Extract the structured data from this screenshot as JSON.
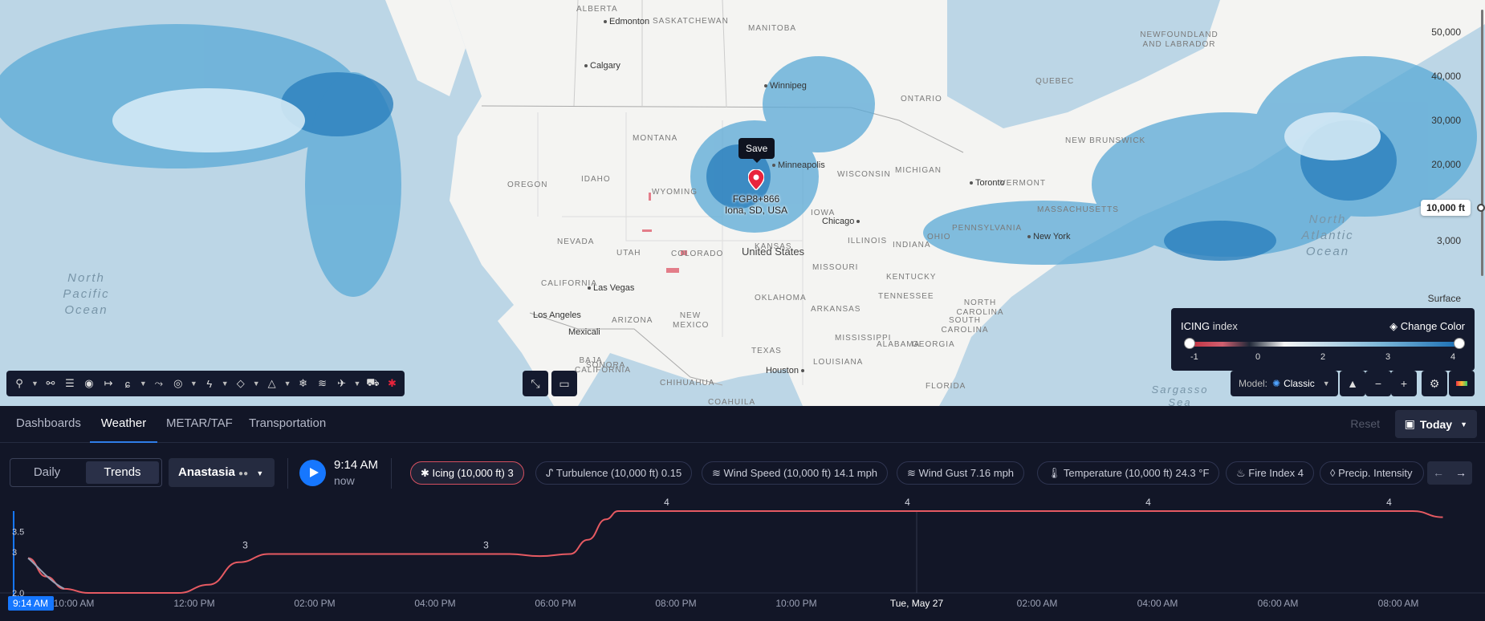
{
  "map": {
    "labels": {
      "alberta": "ALBERTA",
      "saskatchewan": "SASKATCHEWAN",
      "manitoba": "MANITOBA",
      "ontario": "ONTARIO",
      "newfoundland": "NEWFOUNDLAND AND LABRADOR",
      "quebec": "QUEBEC",
      "newbrunswick": "NEW BRUNSWICK",
      "montana": "MONTANA",
      "idaho": "IDAHO",
      "wyoming": "WYOMING",
      "oregon": "OREGON",
      "nevada": "NEVADA",
      "utah": "UTAH",
      "colorado": "COLORADO",
      "california": "CALIFORNIA",
      "arizona": "ARIZONA",
      "newmexico": "NEW MEXICO",
      "texas": "TEXAS",
      "oklahoma": "OKLAHOMA",
      "kansas": "KANSAS",
      "missouri": "MISSOURI",
      "iowa": "IOWA",
      "illinois": "ILLINOIS",
      "wisconsin": "WISCONSIN",
      "michigan": "MICHIGAN",
      "ohio": "OHIO",
      "indiana": "INDIANA",
      "kentucky": "KENTUCKY",
      "tennessee": "TENNESSEE",
      "arkansas": "ARKANSAS",
      "mississippi": "MISSISSIPPI",
      "louisiana": "LOUISIANA",
      "georgia": "GEORGIA",
      "alabama": "ALABAMA",
      "pennsylvania": "PENNSYLVANIA",
      "vermont": "VERMONT",
      "massachusetts": "MASSACHUSETTS",
      "northcarolina": "NORTH CAROLINA",
      "southcarolina": "SOUTH CAROLINA",
      "florida": "FLORIDA",
      "coahuila": "COAHUILA",
      "chihuahua": "CHIHUAHUA",
      "sonora": "SONORA",
      "baja": "BAJA CALIFORNIA"
    },
    "cities": {
      "edmonton": "Edmonton",
      "calgary": "Calgary",
      "winnipeg": "Winnipeg",
      "minneapolis": "Minneapolis",
      "chicago": "Chicago",
      "toronto": "Toronto",
      "newyork": "New York",
      "lasvegas": "Las Vegas",
      "losangeles": "Los Angeles",
      "mexicali": "Mexicali",
      "houston": "Houston"
    },
    "country": "United States",
    "oceans": {
      "np": "North Pacific Ocean",
      "na": "North Atlantic Ocean",
      "sargasso": "Sargasso Sea"
    },
    "marker": {
      "code": "FGP8+866",
      "place": "Iona, SD, USA",
      "save": "Save"
    }
  },
  "altitude": {
    "levels": [
      "50,000",
      "40,000",
      "30,000",
      "20,000",
      "3,000",
      "Surface"
    ],
    "selected": "10,000 ft"
  },
  "legend": {
    "name": "ICING",
    "suffix": "index",
    "change": "Change Color",
    "ticks": [
      "-1",
      "0",
      "2",
      "3",
      "4"
    ],
    "colors": {
      "low": "#c03040",
      "high": "#1a6fb5"
    }
  },
  "model": {
    "label": "Model:",
    "value": "Classic"
  },
  "map_tools": {
    "icons": [
      "pin-icon",
      "pins-icon",
      "sliders-icon",
      "compass-icon",
      "route-icon",
      "hurricane-icon",
      "plane-path-icon",
      "radar-icon",
      "lightning-icon",
      "layers-icon",
      "warning-icon",
      "snow-icon",
      "wind-icon",
      "airplane-icon",
      "truck-icon",
      "asterisk-icon"
    ]
  },
  "tabs": [
    "Dashboards",
    "Weather",
    "METAR/TAF",
    "Transportation"
  ],
  "active_tab": "Weather",
  "reset": "Reset",
  "today": "Today",
  "view_toggle": [
    "Daily",
    "Trends"
  ],
  "user": "Anastasia",
  "time": {
    "value": "9:14 AM",
    "sub": "now"
  },
  "chips": [
    "Icing (10,000 ft) 3",
    "Turbulence (10,000 ft) 0.15",
    "Wind Speed (10,000 ft) 14.1 mph",
    "Wind Gust 7.16 mph",
    "Temperature (10,000 ft) 24.3 °F",
    "Fire Index 4",
    "Precip. Intensity"
  ],
  "chart_data": {
    "type": "line",
    "ylim": [
      2.0,
      4.0
    ],
    "yticks": [
      "3.5",
      "3",
      "2.0"
    ],
    "x_ticks": [
      "10:00 AM",
      "12:00 PM",
      "02:00 PM",
      "04:00 PM",
      "06:00 PM",
      "08:00 PM",
      "10:00 PM",
      "Tue, May 27",
      "02:00 AM",
      "04:00 AM",
      "06:00 AM",
      "08:00 AM"
    ],
    "current_label": "9:14 AM",
    "series": [
      {
        "x_hours": [
          0,
          0.3,
          0.6,
          1.0,
          1.5,
          2.0,
          2.5,
          3.0,
          3.5,
          4.0,
          4.5,
          5.0,
          6.0,
          7.0,
          8.0,
          8.5,
          9.0,
          9.3,
          9.6,
          9.8,
          10.0,
          11.0,
          12.0,
          13.0,
          14.0,
          15.0,
          16.0,
          17.0,
          18.0,
          19.0,
          20.0,
          21.0,
          22.0,
          23.0,
          23.5
        ],
        "values": [
          2.85,
          2.4,
          2.1,
          2.0,
          2.0,
          2.0,
          2.0,
          2.2,
          2.75,
          2.95,
          2.95,
          2.95,
          2.95,
          2.95,
          2.95,
          2.9,
          2.95,
          3.3,
          3.8,
          4.0,
          4.0,
          4.0,
          4.0,
          4.0,
          4.0,
          4.0,
          4.0,
          4.0,
          4.0,
          4.0,
          4.0,
          4.0,
          4.0,
          4.0,
          3.85
        ]
      }
    ],
    "data_labels": [
      {
        "x_hours": 3.5,
        "text": "3"
      },
      {
        "x_hours": 7.5,
        "text": "3"
      },
      {
        "x_hours": 10.5,
        "text": "4"
      },
      {
        "x_hours": 14.5,
        "text": "4"
      },
      {
        "x_hours": 18.5,
        "text": "4"
      },
      {
        "x_hours": 22.5,
        "text": "4"
      }
    ]
  }
}
